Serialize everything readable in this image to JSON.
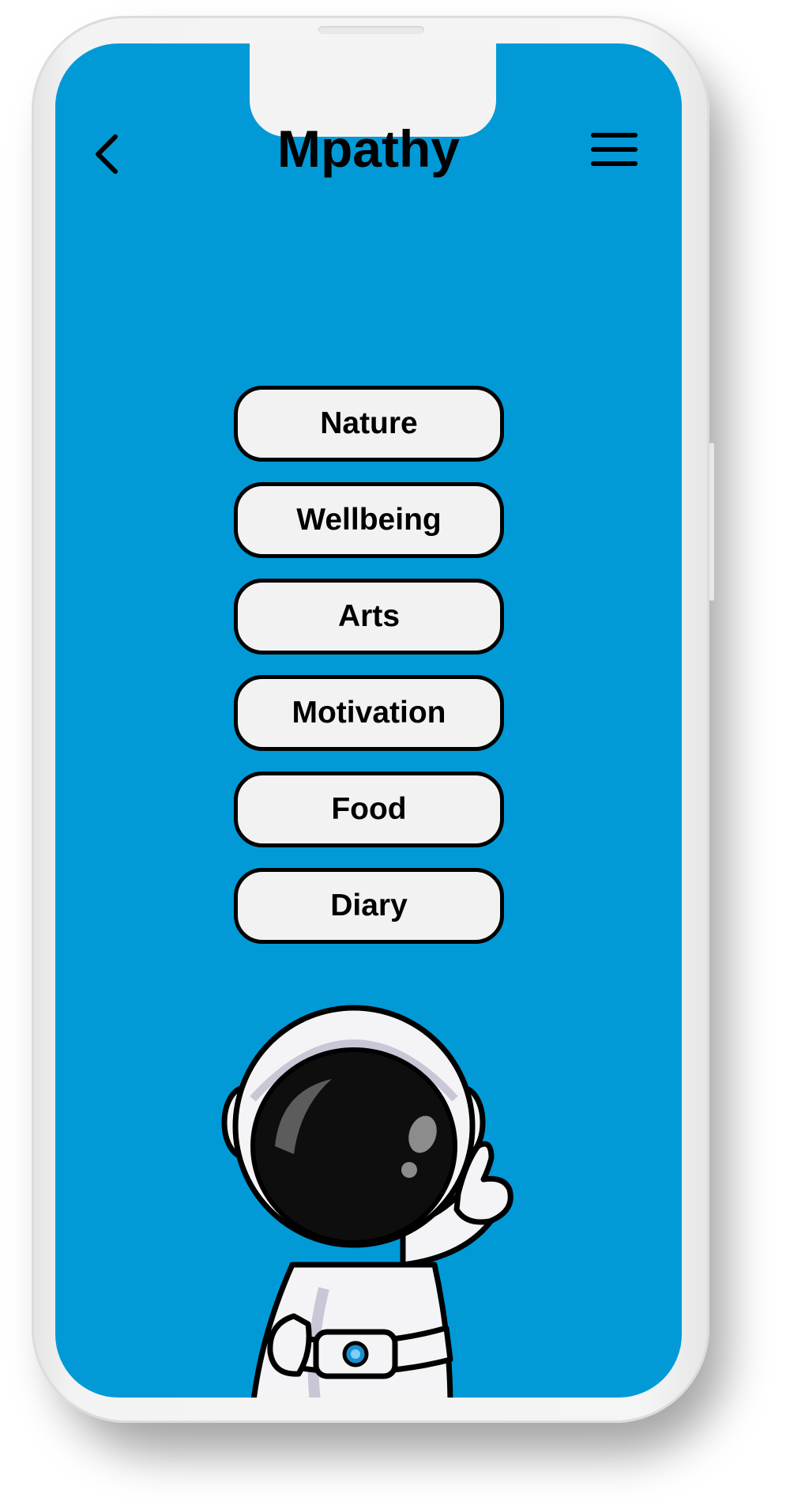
{
  "header": {
    "title": "Mpathy",
    "back_icon": "chevron-left-icon",
    "menu_icon": "hamburger-menu-icon"
  },
  "categories": [
    {
      "label": "Nature"
    },
    {
      "label": "Wellbeing"
    },
    {
      "label": "Arts"
    },
    {
      "label": "Motivation"
    },
    {
      "label": "Food"
    },
    {
      "label": "Diary"
    }
  ],
  "mascot": {
    "icon": "astronaut-illustration"
  },
  "colors": {
    "screen_background": "#019ad7",
    "button_fill": "#f2f2f2",
    "button_border": "#000000",
    "text": "#000000"
  }
}
